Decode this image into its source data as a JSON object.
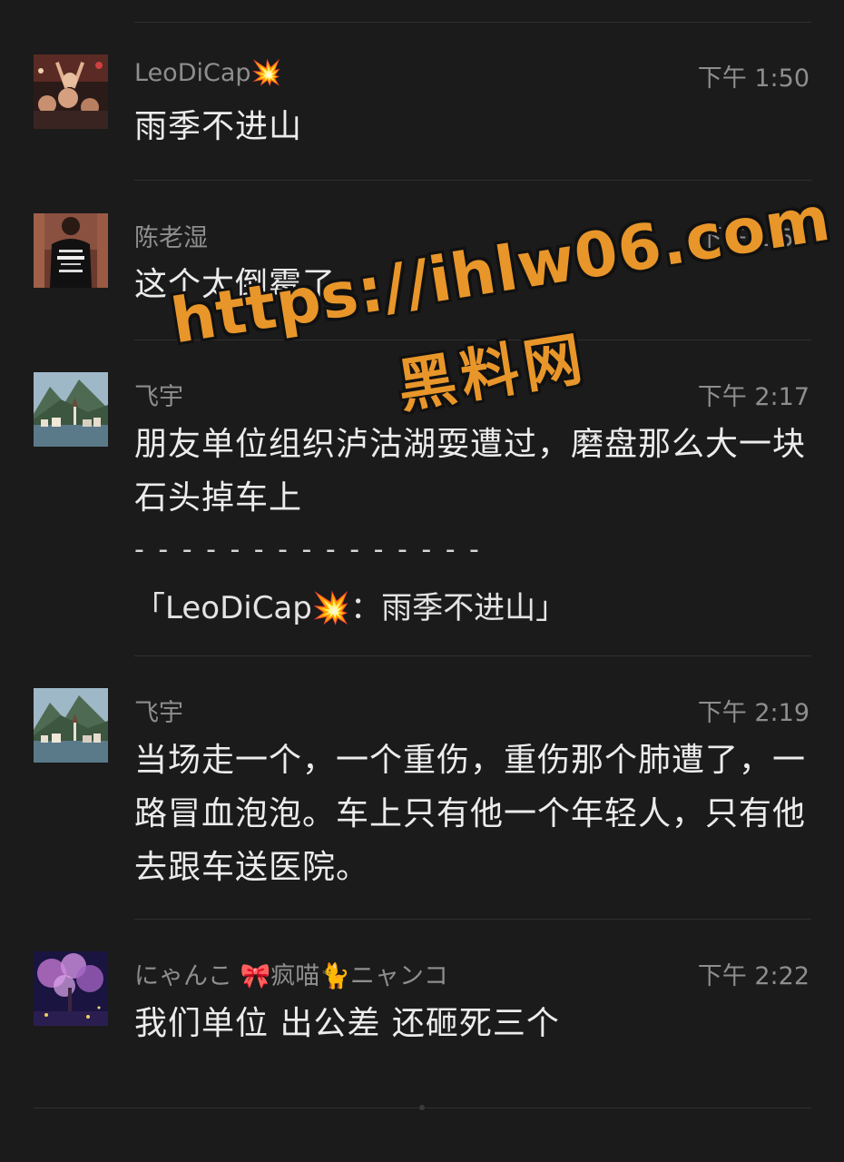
{
  "messages": [
    {
      "name": "LeoDiCap💥",
      "time": "下午 1:50",
      "text": "雨季不进山",
      "avatar": "concert-crowd-avatar"
    },
    {
      "name": "陈老湿",
      "time": "下午 1:54",
      "text": "这个太倒霉了",
      "avatar": "black-tshirt-avatar"
    },
    {
      "name": "飞宇",
      "time": "下午 2:17",
      "text": "朋友单位组织泸沽湖耍遭过，磨盘那么大一块石头掉车上",
      "quote_separator": "- - - - - - - - - - - - - - -",
      "quote": "「LeoDiCap💥：雨季不进山」",
      "avatar": "mountain-lake-village-avatar"
    },
    {
      "name": "飞宇",
      "time": "下午 2:19",
      "text": "当场走一个，一个重伤，重伤那个肺遭了，一路冒血泡泡。车上只有他一个年轻人，只有他去跟车送医院。",
      "avatar": "mountain-lake-village-avatar"
    },
    {
      "name": "にゃんこ 🎀疯喵🐈ニャンコ",
      "time": "下午 2:22",
      "text": "我们单位 出公差 还砸死三个",
      "avatar": "purple-blossom-night-avatar"
    }
  ],
  "watermark": {
    "url": "https://ihlw06.com",
    "label": "黑料网",
    "color": "#e8962a"
  }
}
